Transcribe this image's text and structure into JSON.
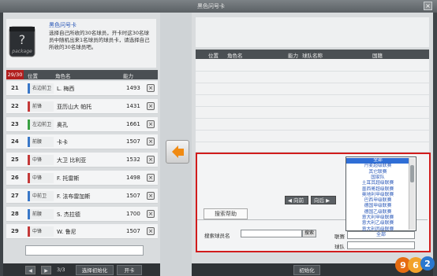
{
  "window": {
    "title": "黑色问号卡"
  },
  "pack": {
    "icon_label": "package",
    "title": "黑色问号卡",
    "description": "选择自己所收的30名球员，开卡时这30名球员中随机出来1名球员的球员卡，请选择自己所收的30名球员吧。"
  },
  "left_list": {
    "count": "29/30",
    "headers": {
      "pos": "位置",
      "name": "角色名",
      "ability": "能力"
    },
    "rows": [
      {
        "num": "21",
        "pos": "右边前卫",
        "name": "L. 梅西",
        "ability": "1493",
        "color": "#3a78c8"
      },
      {
        "num": "22",
        "pos": "前锋",
        "name": "亚历山大 帕托",
        "ability": "1431",
        "color": "#c43a3a"
      },
      {
        "num": "23",
        "pos": "左边前卫",
        "name": "奥孔",
        "ability": "1661",
        "color": "#3aa043"
      },
      {
        "num": "24",
        "pos": "前腰",
        "name": "卡卡",
        "ability": "1507",
        "color": "#3a78c8"
      },
      {
        "num": "25",
        "pos": "中锋",
        "name": "大卫 比利亚",
        "ability": "1532",
        "color": "#c43a3a"
      },
      {
        "num": "26",
        "pos": "中锋",
        "name": "F. 托雷斯",
        "ability": "1498",
        "color": "#c43a3a"
      },
      {
        "num": "27",
        "pos": "中前卫",
        "name": "F. 法布雷加斯",
        "ability": "1507",
        "color": "#3a78c8"
      },
      {
        "num": "28",
        "pos": "前腰",
        "name": "S. 杰拉德",
        "ability": "1700",
        "color": "#3a78c8"
      },
      {
        "num": "29",
        "pos": "中锋",
        "name": "W. 鲁尼",
        "ability": "1507",
        "color": "#c43a3a"
      }
    ],
    "page": "3/3",
    "reset_label": "选择初始化",
    "open_label": "开卡"
  },
  "right_panel": {
    "headers": {
      "pos": "位置",
      "name": "角色名",
      "ability": "能力",
      "team": "球队名称",
      "nation": "国籍"
    },
    "prev_label": "向前",
    "next_label": "向后",
    "search_tab": "搜索帮助",
    "search_name_label": "搜索球员名",
    "search_button": "搜索",
    "league_label": "联赛",
    "team_label": "球队",
    "league_value": "全部",
    "league_options": [
      "全部",
      "丹麦超级联赛",
      "其它联赛",
      "国家队",
      "土耳其超级联赛",
      "墨西哥超级联赛",
      "奥地利甲级联赛",
      "巴西甲级联赛",
      "德国甲级联赛",
      "德国乙级联赛",
      "意大利甲级联赛",
      "意大利乙级联赛",
      "意大利丙级联赛"
    ],
    "reset_label": "初始化"
  },
  "logo": {
    "text": "962"
  }
}
